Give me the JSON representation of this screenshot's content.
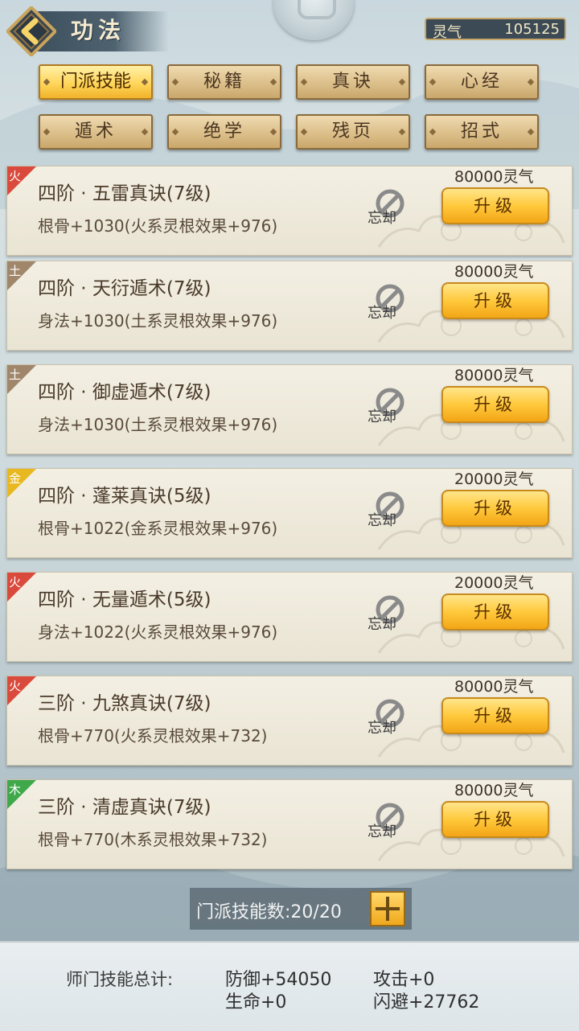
{
  "header": {
    "title": "功法",
    "currency_label": "灵气",
    "currency_value": "105125"
  },
  "tabs": [
    {
      "label": "门派技能",
      "active": true
    },
    {
      "label": "秘籍",
      "active": false
    },
    {
      "label": "真诀",
      "active": false
    },
    {
      "label": "心经",
      "active": false
    },
    {
      "label": "遁术",
      "active": false
    },
    {
      "label": "绝学",
      "active": false
    },
    {
      "label": "残页",
      "active": false
    },
    {
      "label": "招式",
      "active": false
    }
  ],
  "skills": [
    {
      "element": "火",
      "element_color": "#d94a3c",
      "name": "四阶 · 五雷真诀(7级)",
      "effect": "根骨+1030(火系灵根效果+976)",
      "cost": "80000灵气",
      "forget": "忘却",
      "upgrade": "升级"
    },
    {
      "element": "土",
      "element_color": "#a0866a",
      "name": "四阶 · 天衍遁术(7级)",
      "effect": "身法+1030(土系灵根效果+976)",
      "cost": "80000灵气",
      "forget": "忘却",
      "upgrade": "升级"
    },
    {
      "element": "土",
      "element_color": "#a0866a",
      "name": "四阶 · 御虚遁术(7级)",
      "effect": "身法+1030(土系灵根效果+976)",
      "cost": "80000灵气",
      "forget": "忘却",
      "upgrade": "升级"
    },
    {
      "element": "金",
      "element_color": "#e8b820",
      "name": "四阶 · 蓬莱真诀(5级)",
      "effect": "根骨+1022(金系灵根效果+976)",
      "cost": "20000灵气",
      "forget": "忘却",
      "upgrade": "升级"
    },
    {
      "element": "火",
      "element_color": "#d94a3c",
      "name": "四阶 · 无量遁术(5级)",
      "effect": "身法+1022(火系灵根效果+976)",
      "cost": "20000灵气",
      "forget": "忘却",
      "upgrade": "升级"
    },
    {
      "element": "火",
      "element_color": "#d94a3c",
      "name": "三阶 · 九煞真诀(7级)",
      "effect": "根骨+770(火系灵根效果+732)",
      "cost": "80000灵气",
      "forget": "忘却",
      "upgrade": "升级"
    },
    {
      "element": "木",
      "element_color": "#3ea84a",
      "name": "三阶 · 清虚真诀(7级)",
      "effect": "根骨+770(木系灵根效果+732)",
      "cost": "80000灵气",
      "forget": "忘却",
      "upgrade": "升级"
    }
  ],
  "slots": {
    "text": "门派技能数:20/20"
  },
  "summary": {
    "label": "师门技能总计:",
    "defense": "防御+54050",
    "attack": "攻击+0",
    "hp": "生命+0",
    "dodge": "闪避+27762"
  }
}
